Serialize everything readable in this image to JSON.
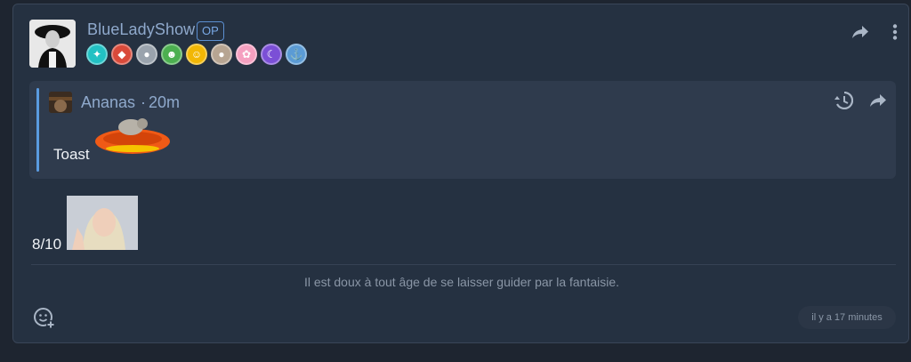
{
  "post": {
    "author": "BlueLadyShow",
    "op_label": "OP",
    "badges": [
      {
        "icon": "star-gem-icon",
        "color": "#22c1c3",
        "glyph": "✦"
      },
      {
        "icon": "red-gem-icon",
        "color": "#d94a3a",
        "glyph": "◆"
      },
      {
        "icon": "robot-icon",
        "color": "#9aa3ad",
        "glyph": "●"
      },
      {
        "icon": "elf-icon",
        "color": "#4caf50",
        "glyph": "☻"
      },
      {
        "icon": "smiley-icon",
        "color": "#f2b705",
        "glyph": "☺"
      },
      {
        "icon": "bear-icon",
        "color": "#b7a592",
        "glyph": "●"
      },
      {
        "icon": "anime-girl-icon",
        "color": "#f5a0c0",
        "glyph": "✿"
      },
      {
        "icon": "moon-icon",
        "color": "#7b4fd6",
        "glyph": "☾"
      },
      {
        "icon": "ship-icon",
        "color": "#5b9bd5",
        "glyph": "⚓"
      }
    ],
    "text": "8/10",
    "signature": "Il est doux à tout âge de se laisser guider par la fantaisie.",
    "time": "il y a 17 minutes"
  },
  "quote": {
    "author": "Ananas",
    "separator": "·",
    "time": "20m",
    "text": "Toast"
  },
  "colors": {
    "accent": "#5a9be0",
    "username": "#8fa9cc",
    "card_bg": "#253141",
    "quote_bg": "#2f3b4d"
  }
}
